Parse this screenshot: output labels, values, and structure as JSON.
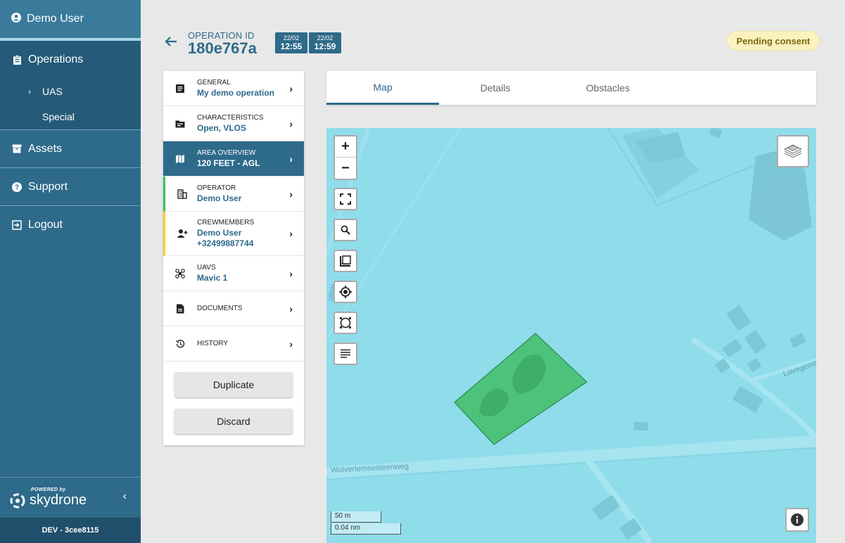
{
  "sidebar": {
    "user": "Demo User",
    "items": [
      {
        "label": "Operations"
      },
      {
        "label": "Assets"
      },
      {
        "label": "Support"
      },
      {
        "label": "Logout"
      }
    ],
    "sub_items": [
      "UAS",
      "Special"
    ],
    "brand": {
      "powered": "POWERED by",
      "name": "skydrone"
    },
    "build": "DEV - 3cee8115"
  },
  "header": {
    "operation_label": "OPERATION ID",
    "operation_id": "180e767a",
    "start": {
      "date": "22/02",
      "time": "12:55"
    },
    "end": {
      "date": "22/02",
      "time": "12:59"
    },
    "status": "Pending consent"
  },
  "steps": [
    {
      "label": "GENERAL",
      "value": "My demo operation"
    },
    {
      "label": "CHARACTERISTICS",
      "value": "Open, VLOS"
    },
    {
      "label": "AREA OVERVIEW",
      "value": "120 FEET - AGL"
    },
    {
      "label": "OPERATOR",
      "value": "Demo User"
    },
    {
      "label": "CREWMEMBERS",
      "value": "Demo User",
      "value2": "+32499887744"
    },
    {
      "label": "UAVS",
      "value": "Mavic 1"
    },
    {
      "label": "DOCUMENTS"
    },
    {
      "label": "HISTORY"
    }
  ],
  "actions": {
    "duplicate": "Duplicate",
    "discard": "Discard"
  },
  "tabs": [
    "Map",
    "Details",
    "Obstacles"
  ],
  "map": {
    "zoom_in": "+",
    "zoom_out": "−",
    "scale_m": "50 m",
    "scale_nm": "0.04 nm",
    "streets": [
      "Wolvertemsesteenweg",
      "Lovegems",
      "uitstr"
    ],
    "area_color": "#4cc27a",
    "water_color": "#8fdceb"
  },
  "colors": {
    "primary": "#2e6a8a",
    "badge_bg": "#fbf2bf",
    "operator_bar": "#3bbf5a",
    "crew_bar": "#f2d12b"
  }
}
